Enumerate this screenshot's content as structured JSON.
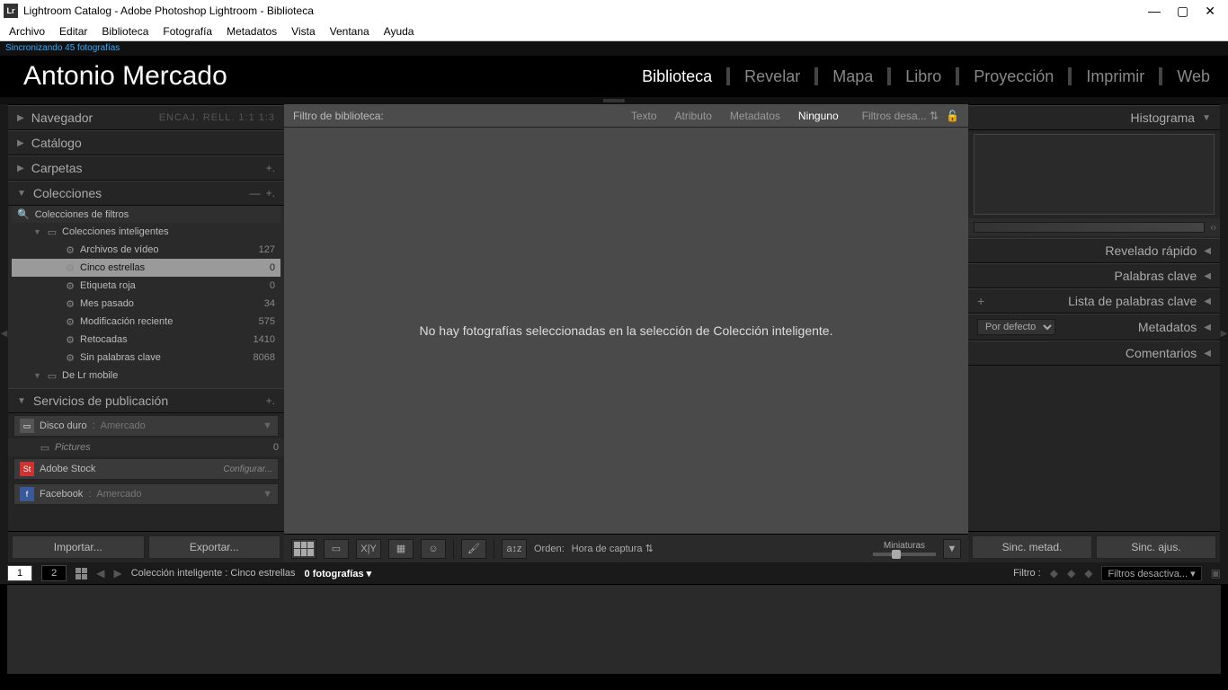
{
  "titlebar": {
    "title": "Lightroom Catalog - Adobe Photoshop Lightroom - Biblioteca"
  },
  "menubar": [
    "Archivo",
    "Editar",
    "Biblioteca",
    "Fotografía",
    "Metadatos",
    "Vista",
    "Ventana",
    "Ayuda"
  ],
  "sync_msg": "Sincronizando 45 fotografías",
  "identity_name": "Antonio Mercado",
  "modules": [
    "Biblioteca",
    "Revelar",
    "Mapa",
    "Libro",
    "Proyección",
    "Imprimir",
    "Web"
  ],
  "left": {
    "navegador": {
      "title": "Navegador",
      "modes": [
        "ENCAJ.",
        "RELL.",
        "1:1",
        "1:3"
      ]
    },
    "catalogo": "Catálogo",
    "carpetas": "Carpetas",
    "colecciones": {
      "title": "Colecciones",
      "filter_header": "Colecciones de filtros",
      "smart_header": "Colecciones inteligentes",
      "items": [
        {
          "label": "Archivos de vídeo",
          "count": "127"
        },
        {
          "label": "Cinco estrellas",
          "count": "0"
        },
        {
          "label": "Etiqueta roja",
          "count": "0"
        },
        {
          "label": "Mes pasado",
          "count": "34"
        },
        {
          "label": "Modificación reciente",
          "count": "575"
        },
        {
          "label": "Retocadas",
          "count": "1410"
        },
        {
          "label": "Sin palabras clave",
          "count": "8068"
        }
      ],
      "mobile": "De Lr mobile"
    },
    "publish": {
      "title": "Servicios de publicación",
      "harddrive": {
        "label": "Disco duro",
        "user": "Amercado"
      },
      "pictures": {
        "label": "Pictures",
        "count": "0"
      },
      "stock": {
        "label": "Adobe Stock",
        "config": "Configurar..."
      },
      "facebook": {
        "label": "Facebook",
        "user": "Amercado"
      }
    },
    "import_btn": "Importar...",
    "export_btn": "Exportar..."
  },
  "center": {
    "filter_label": "Filtro de biblioteca:",
    "tabs": [
      "Texto",
      "Atributo",
      "Metadatos",
      "Ninguno"
    ],
    "preset": "Filtros desa...",
    "empty_msg": "No hay fotografías seleccionadas en la selección de Colección inteligente.",
    "sort_label": "Orden:",
    "sort_value": "Hora de captura",
    "thumb_label": "Miniaturas"
  },
  "right": {
    "histograma": "Histograma",
    "quick": "Revelado rápido",
    "keywords": "Palabras clave",
    "keywordlist": "Lista de palabras clave",
    "metadata": "Metadatos",
    "metadata_preset": "Por defecto",
    "comments": "Comentarios",
    "sync_meta": "Sinc. metad.",
    "sync_adj": "Sinc. ajus."
  },
  "statusbar": {
    "page1": "1",
    "page2": "2",
    "breadcrumb": "Colección inteligente : Cinco estrellas",
    "count": "0 fotografías",
    "filter_lbl": "Filtro :",
    "filter_preset": "Filtros desactiva..."
  }
}
